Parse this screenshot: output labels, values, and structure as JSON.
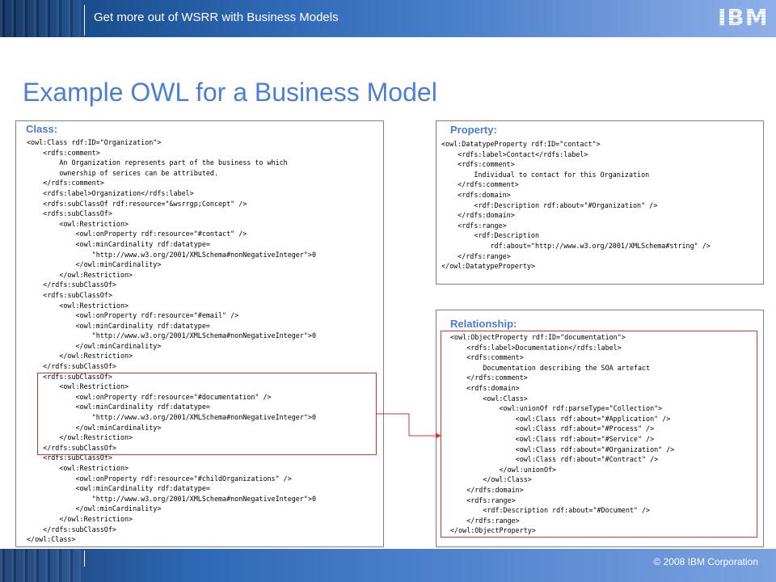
{
  "header": {
    "title": "Get more out of WSRR with Business Models",
    "logo_text": "IBM"
  },
  "page_title": "Example OWL for a Business Model",
  "panels": {
    "class": {
      "label": "Class:",
      "code": "<owl:Class rdf:ID=\"Organization\">\n    <rdfs:comment>\n        An Organization represents part of the business to which\n        ownership of serices can be attributed.\n    </rdfs:comment>\n    <rdfs:label>Organization</rdfs:label>\n    <rdfs:subClassOf rdf:resource=\"&wsrrgp;Concept\" />\n    <rdfs:subClassOf>\n        <owl:Restriction>\n            <owl:onProperty rdf:resource=\"#contact\" />\n            <owl:minCardinality rdf:datatype=\n                \"http://www.w3.org/2001/XMLSchema#nonNegativeInteger\">0\n            </owl:minCardinality>\n        </owl:Restriction>\n    </rdfs:subClassOf>\n    <rdfs:subClassOf>\n        <owl:Restriction>\n            <owl:onProperty rdf:resource=\"#email\" />\n            <owl:minCardinality rdf:datatype=\n                \"http://www.w3.org/2001/XMLSchema#nonNegativeInteger\">0\n            </owl:minCardinality>\n        </owl:Restriction>\n    </rdfs:subClassOf>\n    <rdfs:subClassOf>\n        <owl:Restriction>\n            <owl:onProperty rdf:resource=\"#documentation\" />\n            <owl:minCardinality rdf:datatype=\n                \"http://www.w3.org/2001/XMLSchema#nonNegativeInteger\">0\n            </owl:minCardinality>\n        </owl:Restriction>\n    </rdfs:subClassOf>\n    <rdfs:subClassOf>\n        <owl:Restriction>\n            <owl:onProperty rdf:resource=\"#childOrganizations\" />\n            <owl:minCardinality rdf:datatype=\n                \"http://www.w3.org/2001/XMLSchema#nonNegativeInteger\">0\n            </owl:minCardinality>\n        </owl:Restriction>\n    </rdfs:subClassOf>\n</owl:Class>"
    },
    "property": {
      "label": "Property:",
      "code": "<owl:DatatypeProperty rdf:ID=\"contact\">\n    <rdfs:label>Contact</rdfs:label>\n    <rdfs:comment>\n        Individual to contact for this Organization\n    </rdfs:comment>\n    <rdfs:domain>\n        <rdf:Description rdf:about=\"#Organization\" />\n    </rdfs:domain>\n    <rdfs:range>\n        <rdf:Description\n            rdf:about=\"http://www.w3.org/2001/XMLSchema#string\" />\n    </rdfs:range>\n</owl:DatatypeProperty>"
    },
    "relationship": {
      "label": "Relationship:",
      "code": "<owl:ObjectProperty rdf:ID=\"documentation\">\n    <rdfs:label>Documentation</rdfs:label>\n    <rdfs:comment>\n        Documentation describing the SOA artefact\n    </rdfs:comment>\n    <rdfs:domain>\n        <owl:Class>\n            <owl:unionOf rdf:parseType=\"Collection\">\n                <owl:Class rdf:about=\"#Application\" />\n                <owl:Class rdf:about=\"#Process\" />\n                <owl:Class rdf:about=\"#Service\" />\n                <owl:Class rdf:about=\"#Organization\" />\n                <owl:Class rdf:about=\"#Contract\" />\n            </owl:unionOf>\n        </owl:Class>\n    </rdfs:domain>\n    <rdfs:range>\n        <rdf:Description rdf:about=\"#Document\" />\n    </rdfs:range>\n</owl:ObjectProperty>"
    }
  },
  "footer": {
    "copyright": "© 2008 IBM Corporation"
  },
  "colors": {
    "accent": "#4c7ed6",
    "highlight": "#d93030"
  }
}
